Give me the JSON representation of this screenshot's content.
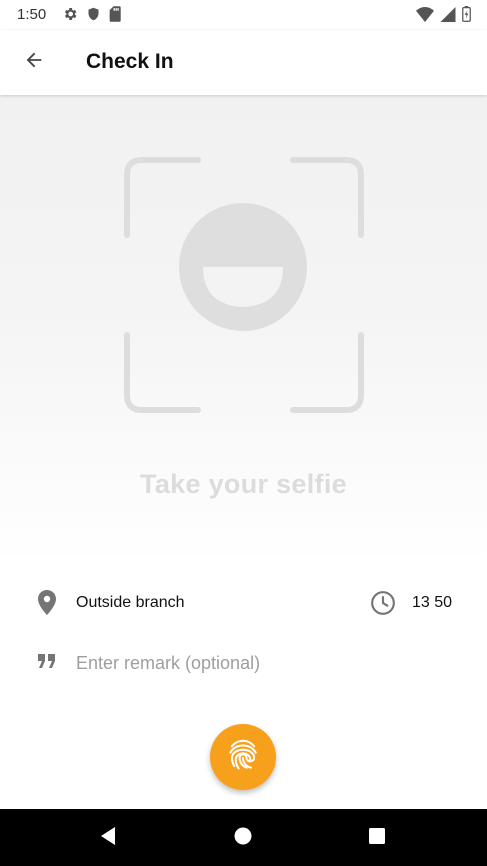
{
  "status_bar": {
    "time": "1:50",
    "left_icons": [
      "settings-icon",
      "shield-icon",
      "sd-card-icon"
    ],
    "right_icons": [
      "wifi-icon",
      "signal-icon",
      "battery-icon"
    ]
  },
  "app_bar": {
    "back_icon": "arrow-back-icon",
    "title": "Check In"
  },
  "selfie": {
    "label": "Take your selfie",
    "icon": "face-frame-icon"
  },
  "location": {
    "icon": "location-pin-icon",
    "text": "Outside branch"
  },
  "time": {
    "icon": "clock-icon",
    "text": "13 50"
  },
  "remark": {
    "icon": "quote-icon",
    "placeholder": "Enter remark (optional)",
    "value": ""
  },
  "fab": {
    "icon": "fingerprint-icon",
    "color": "#f7a01c"
  },
  "nav_bar": {
    "buttons": [
      "back-triangle-icon",
      "home-circle-icon",
      "recents-square-icon"
    ]
  }
}
